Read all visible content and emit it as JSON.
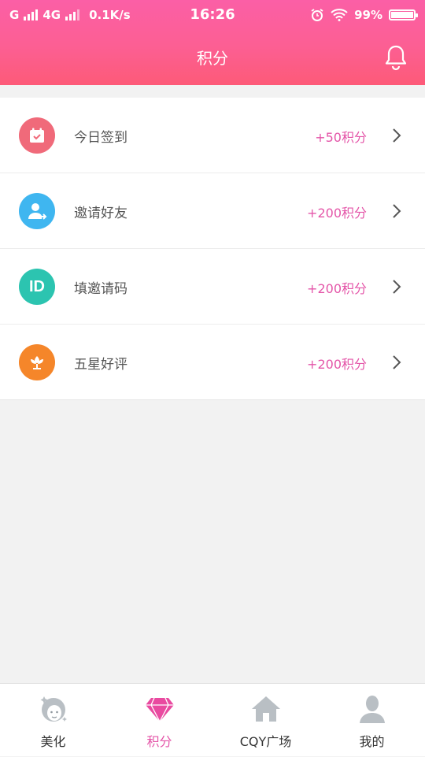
{
  "status_bar": {
    "carrier1": "G",
    "carrier2": "4G",
    "speed": "0.1K/s",
    "time": "16:26",
    "battery": "99%"
  },
  "header": {
    "title": "积分"
  },
  "tasks": [
    {
      "label": "今日签到",
      "points": "+50积分",
      "icon": "calendar-check-icon",
      "color": "#f06a7a"
    },
    {
      "label": "邀请好友",
      "points": "+200积分",
      "icon": "invite-user-icon",
      "color": "#3fb6f0"
    },
    {
      "label": "填邀请码",
      "points": "+200积分",
      "icon": "id-icon",
      "color": "#2cc4b0",
      "icon_text": "ID"
    },
    {
      "label": "五星好评",
      "points": "+200积分",
      "icon": "flower-icon",
      "color": "#f5862a"
    }
  ],
  "tabs": [
    {
      "label": "美化",
      "icon": "face-icon",
      "active": false
    },
    {
      "label": "积分",
      "icon": "diamond-icon",
      "active": true
    },
    {
      "label": "CQY广场",
      "icon": "home-icon",
      "active": false
    },
    {
      "label": "我的",
      "icon": "user-icon",
      "active": false
    }
  ],
  "colors": {
    "accent": "#e455a8",
    "header_top": "#fb5fa6",
    "header_bottom": "#fd5a78"
  }
}
